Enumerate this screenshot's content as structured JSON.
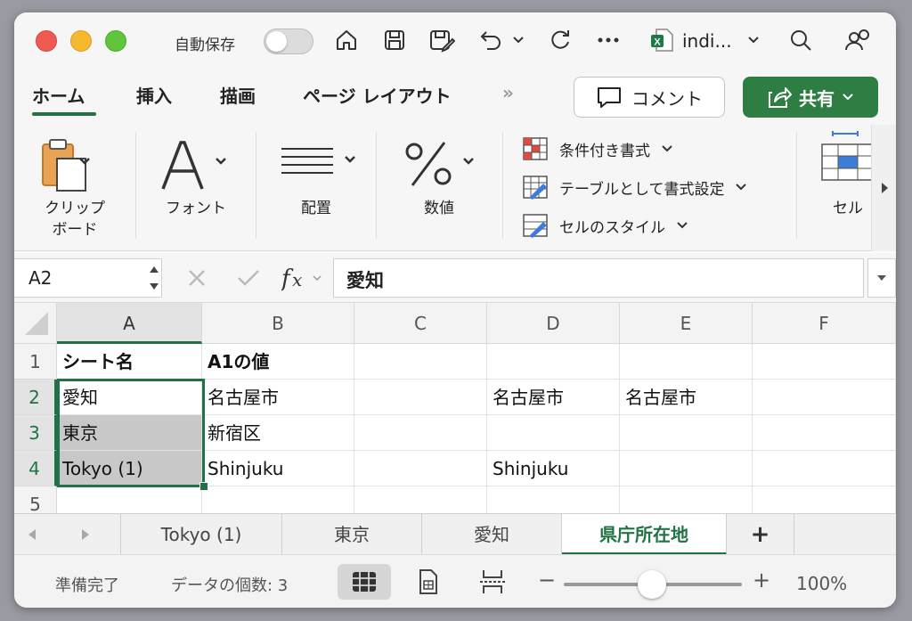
{
  "titlebar": {
    "autosave_label": "自動保存",
    "file_name": "indi...",
    "icons": [
      "home-icon",
      "save-icon",
      "save-as-icon",
      "undo-icon",
      "redo-icon",
      "more-icon",
      "excel-file-icon",
      "search-icon",
      "account-icon"
    ]
  },
  "ribbon": {
    "tabs": [
      "ホーム",
      "挿入",
      "描画",
      "ページ レイアウト"
    ],
    "overflow": "»",
    "comment_label": "コメント",
    "share_label": "共有",
    "groups": {
      "clipboard": "クリップ\nボード",
      "font": "フォント",
      "alignment": "配置",
      "number": "数値",
      "cells": "セル"
    },
    "styles": {
      "conditional": "条件付き書式",
      "table": "テーブルとして書式設定",
      "cell_style": "セルのスタイル"
    }
  },
  "formula": {
    "cell_ref": "A2",
    "value": "愛知"
  },
  "grid": {
    "columns": [
      "A",
      "B",
      "C",
      "D",
      "E",
      "F"
    ],
    "rows": [
      "1",
      "2",
      "3",
      "4",
      "5"
    ],
    "cells": {
      "A1": "シート名",
      "B1": "A1の値",
      "A2": "愛知",
      "B2": "名古屋市",
      "D2": "名古屋市",
      "E2": "名古屋市",
      "A3": "東京",
      "B3": "新宿区",
      "A4": "Tokyo (1)",
      "B4": "Shinjuku",
      "D4": "Shinjuku"
    }
  },
  "sheets": {
    "tabs": [
      "Tokyo (1)",
      "東京",
      "愛知",
      "県庁所在地"
    ],
    "active": "県庁所在地",
    "add": "+"
  },
  "status": {
    "ready": "準備完了",
    "count": "データの個数: 3",
    "zoom": "100%",
    "zoom_minus": "−",
    "zoom_plus": "+"
  }
}
